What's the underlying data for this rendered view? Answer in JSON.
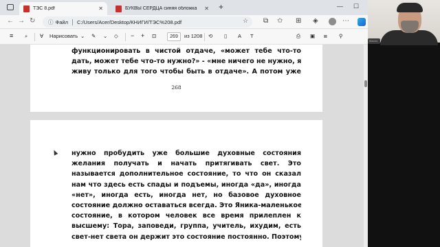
{
  "browser": {
    "tabs": [
      {
        "label": "ТЭС 8.pdf",
        "active": true
      },
      {
        "label": "БУКВЫ СЕРДЦА синяя обложка",
        "active": false
      }
    ],
    "new_tab_symbol": "+",
    "window_controls": {
      "minimize": "—",
      "maximize": "☐"
    },
    "address": {
      "info_label": "Файл",
      "url": "C:/Users/Acer/Desktop/КНИГИ/ТЭС%208.pdf"
    }
  },
  "pdf_toolbar": {
    "draw_label": "Нарисовать",
    "current_page": "269",
    "total_pages": "из 1208"
  },
  "document": {
    "page1": {
      "lines": [
        "функционировать в чистой отдаче, «может тебе что-то",
        "дать, может тебе что-то нужно?» - «мне ничего не нужно, я",
        "живу только для того чтобы быть в отдаче». А потом уже"
      ],
      "page_number": "268"
    },
    "page2": {
      "lines": [
        "нужно пробудить уже большие духовные состояния",
        "желания получать и начать притягивать свет. Это",
        "называется дополнительное состояние, то что он сказал",
        "нам что здесь есть спады и подъемы, иногда «да», иногда",
        "«нет», иногда есть, иногда нет, но базовое духовное",
        "состояние должно оставаться всегда. Это Яника-маленькое",
        "состояние, в котором человек все время прилеплен к",
        "высшему: Тора, заповеди, группа, учитель, ихудим, есть",
        "свет-нет света он держит это состояние постоянно. Поэтому"
      ]
    }
  },
  "webcam": {
    "mic_label": "Maono"
  },
  "colors": {
    "pdf_icon": "#c9302c",
    "viewer_bg": "#dcdcdc",
    "tabbar_bg": "#dfe3e8"
  }
}
